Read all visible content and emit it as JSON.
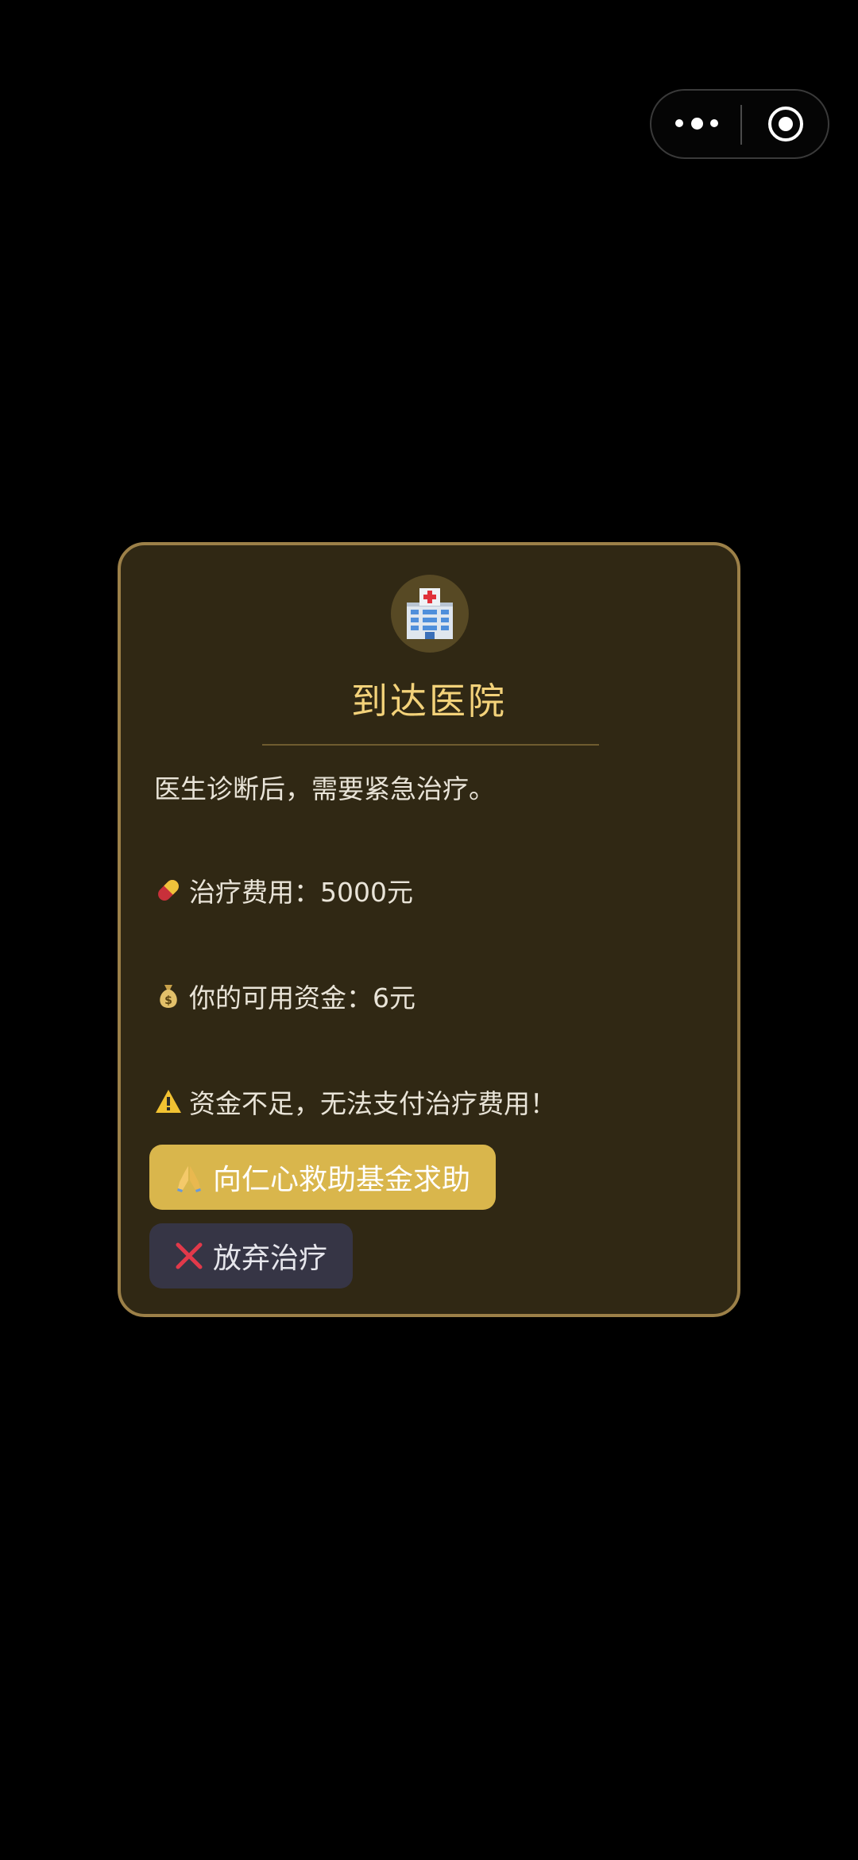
{
  "capsule": {
    "more_icon": "more-dots-icon",
    "close_icon": "target-close-icon"
  },
  "modal": {
    "icon": "hospital-icon",
    "title": "到达医院",
    "diagnosis": "医生诊断后，需要紧急治疗。",
    "treatment_cost_label": "治疗费用：",
    "treatment_cost_value": "5000元",
    "treatment_cost_icon": "pill-icon",
    "funds_label": "你的可用资金：",
    "funds_value": "6元",
    "funds_icon": "money-bag-icon",
    "warning_text": "资金不足，无法支付治疗费用！",
    "warning_icon": "warning-icon"
  },
  "buttons": {
    "help_label": "向仁心救助基金求助",
    "help_icon": "praying-hands-icon",
    "quit_label": "放弃治疗",
    "quit_icon": "cross-mark-icon"
  },
  "colors": {
    "modal_bg": "#302814",
    "modal_border": "#9c8048",
    "title": "#f3d27a",
    "help_button": "#d9b64c",
    "quit_button": "#363545"
  }
}
